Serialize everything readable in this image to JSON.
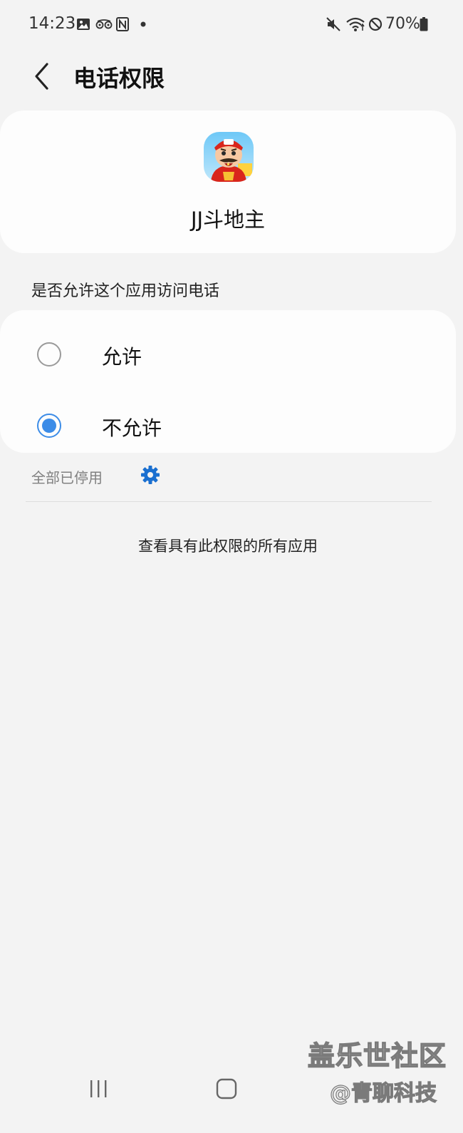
{
  "status_bar": {
    "time": "14:23",
    "battery_percent": "70%",
    "left_icons": [
      "gallery-icon",
      "tripadvisor-icon",
      "nfc-icon",
      "notification-dot-icon"
    ],
    "right_icons": [
      "mute-icon",
      "wifi-icon",
      "do-not-disturb-icon",
      "battery-icon"
    ]
  },
  "header": {
    "title": "电话权限",
    "back_icon": "chevron-left-icon"
  },
  "app": {
    "name": "JJ斗地主",
    "icon": "app-icon"
  },
  "permission": {
    "question": "是否允许这个应用访问电话",
    "options": [
      {
        "label": "允许",
        "selected": false
      },
      {
        "label": "不允许",
        "selected": true
      }
    ]
  },
  "footer": {
    "all_disabled_text": "全部已停用",
    "settings_icon": "gear-icon",
    "view_all_link": "查看具有此权限的所有应用"
  },
  "nav_bar": {
    "buttons": [
      "recent-apps-icon",
      "home-icon"
    ]
  },
  "watermark": {
    "main": "盖乐世社区",
    "sub": "@青聊科技"
  },
  "colors": {
    "background": "#f3f3f3",
    "card": "#fdfdfd",
    "accent": "#3c8ce7",
    "gear": "#1a6fd0"
  }
}
